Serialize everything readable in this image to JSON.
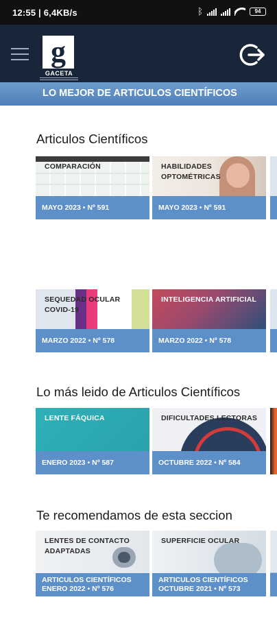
{
  "status_bar": {
    "time": "12:55 | 6,4KB/s",
    "battery": "94"
  },
  "header": {
    "logo_text": "GACETA",
    "tagline": "LO MEJOR DE ARTICULOS CIENTÍFICOS"
  },
  "sections": [
    {
      "title": "Articulos Científicos",
      "cards": [
        {
          "caption": "COMPARACIÓN",
          "meta": "MAYO 2023 • Nº 591"
        },
        {
          "caption": "HABILIDADES OPTOMÉTRICAS",
          "meta": "MAYO 2023 • Nº 591"
        },
        {
          "caption": "SEQUEDAD OCULAR COVID-19",
          "meta": "MARZO 2022 • Nº 578"
        },
        {
          "caption": "INTELIGENCIA ARTIFICIAL",
          "meta": "MARZO 2022 • Nº 578"
        }
      ]
    },
    {
      "title": "Lo más leido de Articulos Científicos",
      "cards": [
        {
          "caption": "LENTE FÁQUICA",
          "meta": "ENERO 2023 • Nº 587"
        },
        {
          "caption": "DIFICULTADES LECTORAS",
          "meta": "OCTUBRE 2022 • Nº 584"
        }
      ]
    },
    {
      "title": "Te recomendamos de esta seccion",
      "cards": [
        {
          "caption": "LENTES DE CONTACTO ADAPTADAS",
          "meta_line1": "ARTICULOS CIENTÍFICOS",
          "meta_line2": "ENERO 2022 • Nº 576"
        },
        {
          "caption": "SUPERFICIE OCULAR",
          "meta_line1": "ARTICULOS CIENTÍFICOS",
          "meta_line2": "OCTUBRE 2021 • Nº 573"
        }
      ]
    }
  ],
  "colors": {
    "header_bg": "#19263a",
    "accent_blue": "#5d8fc8",
    "tagline_bg": "#4f7fb8"
  },
  "icons": [
    "menu-icon",
    "logout-icon",
    "bluetooth-icon",
    "signal-icon",
    "wifi-icon",
    "battery-icon"
  ]
}
